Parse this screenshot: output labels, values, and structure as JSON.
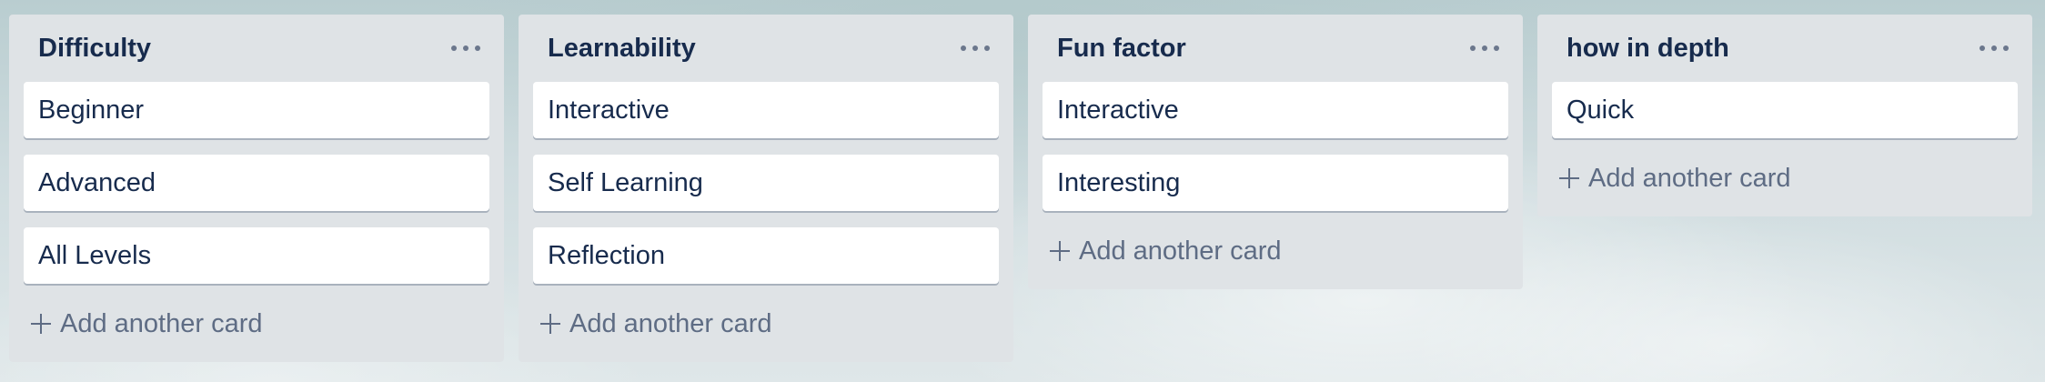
{
  "board": {
    "lists": [
      {
        "title": "Difficulty",
        "cards": [
          "Beginner",
          "Advanced",
          "All Levels"
        ],
        "add_label": "Add another card"
      },
      {
        "title": "Learnability",
        "cards": [
          "Interactive",
          "Self Learning",
          "Reflection"
        ],
        "add_label": "Add another card"
      },
      {
        "title": "Fun factor",
        "cards": [
          "Interactive",
          "Interesting"
        ],
        "add_label": "Add another card"
      },
      {
        "title": "how in depth",
        "cards": [
          "Quick"
        ],
        "add_label": "Add another card"
      }
    ]
  },
  "icons": {
    "list_menu": "more-horizontal-icon",
    "add": "plus-icon"
  },
  "colors": {
    "list_background": "#dfe3e6",
    "card_background": "#ffffff",
    "title_text": "#172b4d",
    "muted_text": "#5e6c84"
  }
}
